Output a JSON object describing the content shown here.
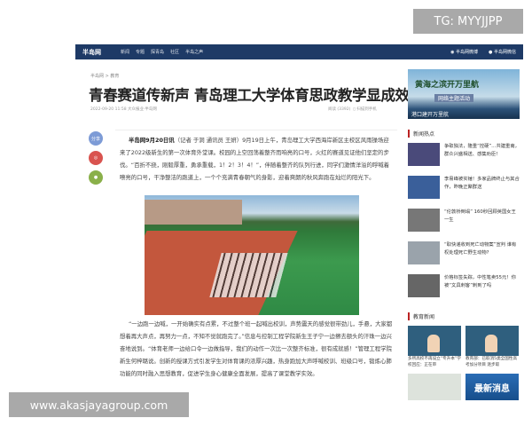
{
  "overlay": {
    "tg": "TG: MYYJJPP",
    "watermark": "www.akasjayagroup.com"
  },
  "nav": {
    "logo": "半岛网",
    "items": [
      "新闻",
      "专题",
      "探青岛",
      "社区",
      "半岛之声"
    ],
    "right": [
      "半岛网微博",
      "半岛网微信"
    ],
    "color": "#1e3a66"
  },
  "article": {
    "breadcrumb": "半岛网 > 教育",
    "title": "青春赛道传新声 青岛理工大学体育思政教学显成效",
    "meta": "2022-09-20 11:58 大众报业·半岛网",
    "reads": "阅读 (3392)",
    "mobile": "扫描到手机",
    "share": [
      "分享",
      "微博",
      "微信"
    ],
    "para1_lead": "半岛网9月20日讯",
    "para1": "（记者 于洞 通讯员 王妍）9月19日上午，青岛理工大学西海岸新区主校区风雨操场迎来了2022级新生的第一次体育外堂课。校园的上空回荡着整齐而响亮的口号，火红的赛道见证他们坚定的步伐。“百折不挠，刚毅厚重，勇承重载，1！2！3！4！”，伴随着整齐的队列行进，同学们激情洋溢的呼喊着嘹亮的口号，干净整洁的跑道上，一个个充满青春朝气的身影，迎着爽朗的秋风奔跑在灿烂的阳光下。",
    "para2": "“一边跑一边喊，一开始确实有点累，不过整个班一起喊出校训，声势震天的感觉很带劲儿，手悬，大家都想着再大声点，再努力一点，不知不觉就跑完了。”信息与控制工程学院新生王子宁一边擦去额头的汗珠一边兴奋地说到。“体育老师一边给口令一边做指导，我们的动作一次比一次整齐标准，很有成就感！”管理工程学院新生何梓璐说。创新的授课方式引发学生对体育课的浓厚兴趣，热身跑加大声呼喊校训、班级口号，锻炼心肺功能的同时融入思想教育，促进学生身心健康全面发展，提高了课堂教学实效。"
  },
  "sidebar": {
    "banner": {
      "line1": "黄海之滨开万里航",
      "line2": "网络主题活动",
      "line3": "港口建开万里航"
    },
    "hot_title": "新闻热点",
    "hot": [
      "争取独法，隆重“控硬”…共建重南，群众兴盛相送、感集劝臣！",
      "李易峰被实锤！多家品牌终止与其合作，昨晚正聚群送",
      "“伦敦桥倒塌” 160秒回顾英国女王一生",
      "“取快递收到死亡动物案”宣判 谁有权处理死亡野生动物?",
      "价格标签失踪，中性笔卖55元！你被“文具刺客”刺到了吗"
    ],
    "edu_title": "教育新闻",
    "edu": [
      "多所高校不再设立“专升本”学校回应：正在审",
      "教育部：已取消5类全国性高考加分项目 逐步取"
    ],
    "latest": "最新消息"
  }
}
